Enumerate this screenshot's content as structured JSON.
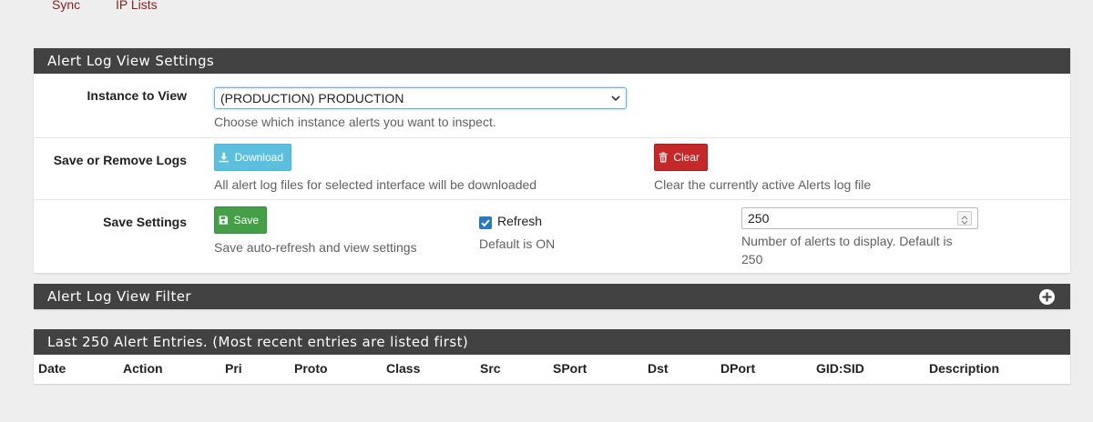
{
  "tabs": [
    {
      "label": "Sync"
    },
    {
      "label": "IP Lists"
    }
  ],
  "settings_panel": {
    "title": "Alert Log View Settings",
    "instance": {
      "label": "Instance to View",
      "selected": "(PRODUCTION) PRODUCTION",
      "help": "Choose which instance alerts you want to inspect."
    },
    "logs": {
      "label": "Save or Remove Logs",
      "download_label": "Download",
      "download_help": "All alert log files for selected interface will be downloaded",
      "clear_label": "Clear",
      "clear_help": "Clear the currently active Alerts log file"
    },
    "save_settings": {
      "label": "Save Settings",
      "save_label": "Save",
      "save_help": "Save auto-refresh and view settings",
      "refresh_label": "Refresh",
      "refresh_checked": true,
      "refresh_help": "Default is ON",
      "count_value": "250",
      "count_help_line1": "Number of alerts to display. Default is",
      "count_help_line2": "250"
    }
  },
  "filter_panel": {
    "title": "Alert Log View Filter",
    "expand_icon": "plus-circle-icon"
  },
  "entries_panel": {
    "title": "Last 250 Alert Entries. (Most recent entries are listed first)",
    "columns": [
      "Date",
      "Action",
      "Pri",
      "Proto",
      "Class",
      "Src",
      "SPort",
      "Dst",
      "DPort",
      "GID:SID",
      "Description"
    ]
  },
  "colors": {
    "heading_bg": "#424242",
    "link": "#8b1e1e",
    "info": "#5bc0de",
    "danger": "#c62828",
    "success": "#43a047",
    "checkbox": "#2878c8"
  }
}
